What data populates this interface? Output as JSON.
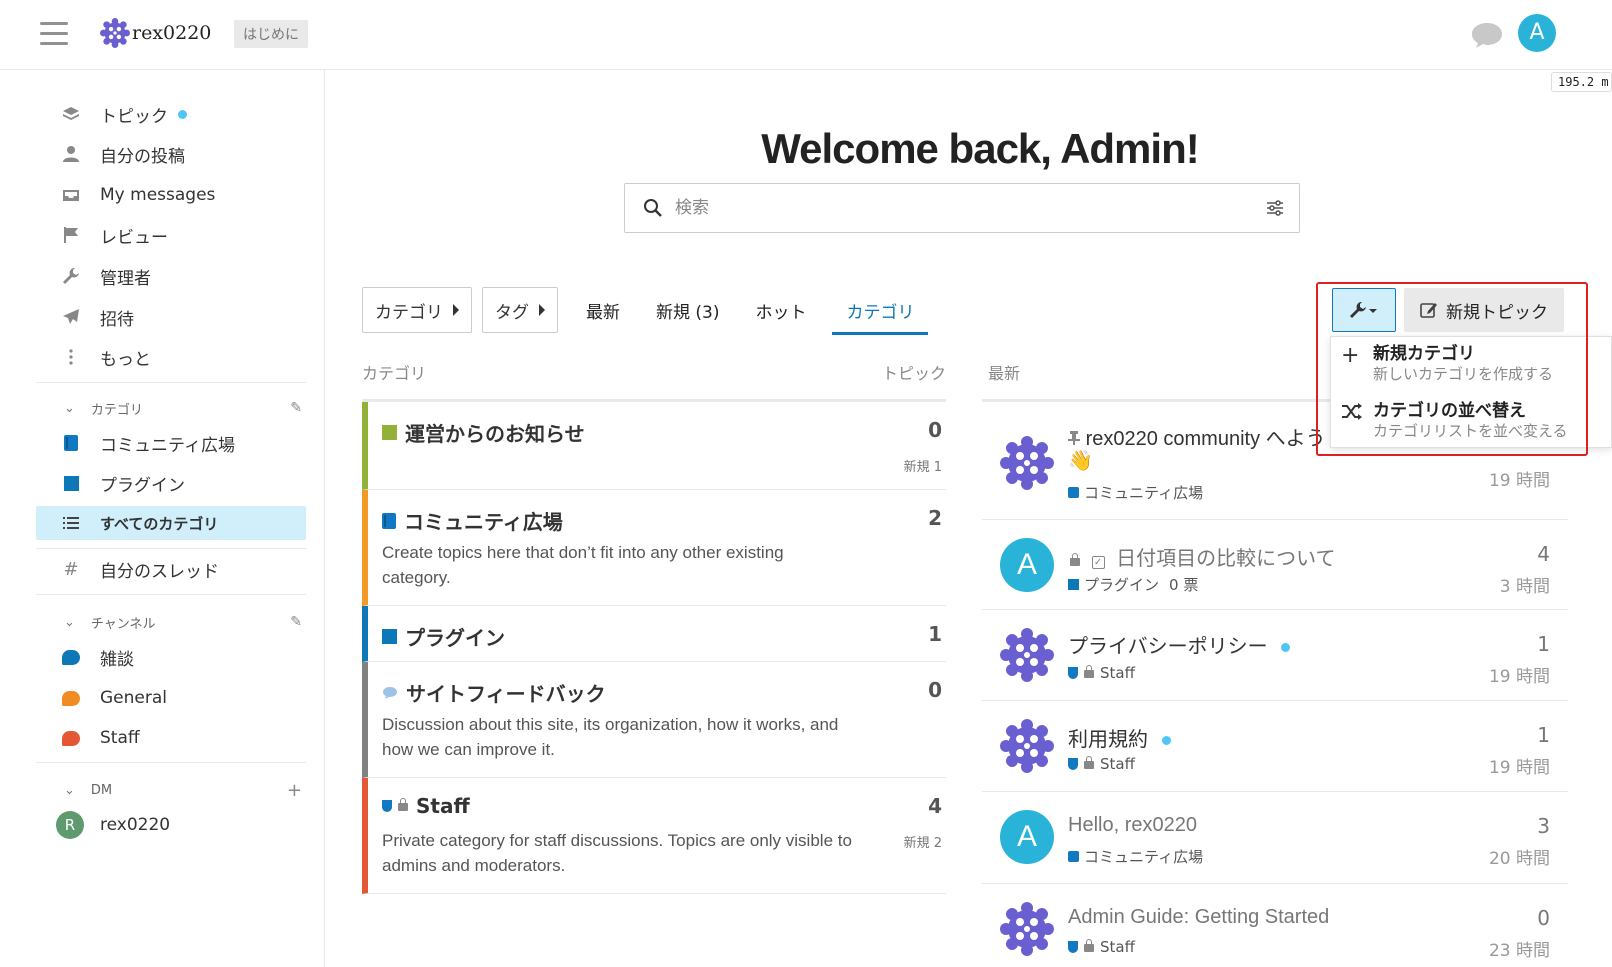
{
  "header": {
    "site_name": "rex0220",
    "welcome_pill": "はじめに",
    "avatar_letter": "A",
    "size_indicator": "195.2 m"
  },
  "sidebar": {
    "items": [
      {
        "label": "トピック",
        "icon": "layers-icon"
      },
      {
        "label": "自分の投稿",
        "icon": "user-icon"
      },
      {
        "label": "My messages",
        "icon": "inbox-icon"
      },
      {
        "label": "レビュー",
        "icon": "flag-icon"
      },
      {
        "label": "管理者",
        "icon": "wrench-icon"
      },
      {
        "label": "招待",
        "icon": "paper-plane-icon"
      },
      {
        "label": "もっと",
        "icon": "ellipsis-vertical-icon"
      }
    ],
    "categories_header": "カテゴリ",
    "categories": [
      {
        "label": "コミュニティ広場",
        "color": "#1079c1"
      },
      {
        "label": "プラグイン",
        "color": "#0d78b8"
      }
    ],
    "all_categories": "すべてのカテゴリ",
    "my_threads": "自分のスレッド",
    "channels_header": "チャンネル",
    "channels": [
      {
        "label": "雑談",
        "color": "#0d78b8"
      },
      {
        "label": "General",
        "color": "#f08c22"
      },
      {
        "label": "Staff",
        "color": "#e45735"
      }
    ],
    "dm_header": "DM",
    "dm_user": {
      "letter": "R",
      "name": "rex0220"
    }
  },
  "main": {
    "welcome": "Welcome back, Admin!",
    "search_placeholder": "検索",
    "nav": {
      "category_dropdown": "カテゴリ",
      "tag_dropdown": "タグ",
      "tabs": [
        "最新",
        "新規 (3)",
        "ホット",
        "カテゴリ"
      ]
    },
    "new_topic_button": "新規トピック",
    "dropdown": [
      {
        "title": "新規カテゴリ",
        "sub": "新しいカテゴリを作成する",
        "icon": "plus-icon"
      },
      {
        "title": "カテゴリの並べ替え",
        "sub": "カテゴリリストを並べ変える",
        "icon": "shuffle-icon"
      }
    ],
    "category_table": {
      "col_category": "カテゴリ",
      "col_topics": "トピック",
      "rows": [
        {
          "name": "運営からのお知らせ",
          "count": "0",
          "new": "新規 1",
          "desc": "",
          "color": "#92b139"
        },
        {
          "name": "コミュニティ広場",
          "count": "2",
          "new": "",
          "desc": "Create topics here that don’t fit into any other existing category.",
          "color": "#f39a26"
        },
        {
          "name": "プラグイン",
          "count": "1",
          "new": "",
          "desc": "",
          "color": "#0d78b8"
        },
        {
          "name": "サイトフィードバック",
          "count": "0",
          "new": "",
          "desc": "Discussion about this site, its organization, how it works, and how we can improve it.",
          "color": "#808281"
        },
        {
          "name": "Staff",
          "count": "4",
          "new": "新規 2",
          "desc": "Private category for staff discussions. Topics are only visible to admins and moderators.",
          "color": "#e45735"
        }
      ]
    },
    "latest": {
      "header": "最新",
      "rows": [
        {
          "title": "rex0220 community へよう",
          "emoji": "👋",
          "category": "コミュニティ広場",
          "count": "",
          "time": "19 時間"
        },
        {
          "title": "日付項目の比較について",
          "category": "プラグイン",
          "votes": "0 票",
          "count": "4",
          "time": "3 時間"
        },
        {
          "title": "プライバシーポリシー",
          "category": "Staff",
          "count": "1",
          "time": "19 時間"
        },
        {
          "title": "利用規約",
          "category": "Staff",
          "count": "1",
          "time": "19 時間"
        },
        {
          "title": "Hello, rex0220",
          "category": "コミュニティ広場",
          "count": "3",
          "time": "20 時間"
        },
        {
          "title": "Admin Guide: Getting Started",
          "category": "Staff",
          "count": "0",
          "time": "23 時間"
        }
      ]
    }
  }
}
